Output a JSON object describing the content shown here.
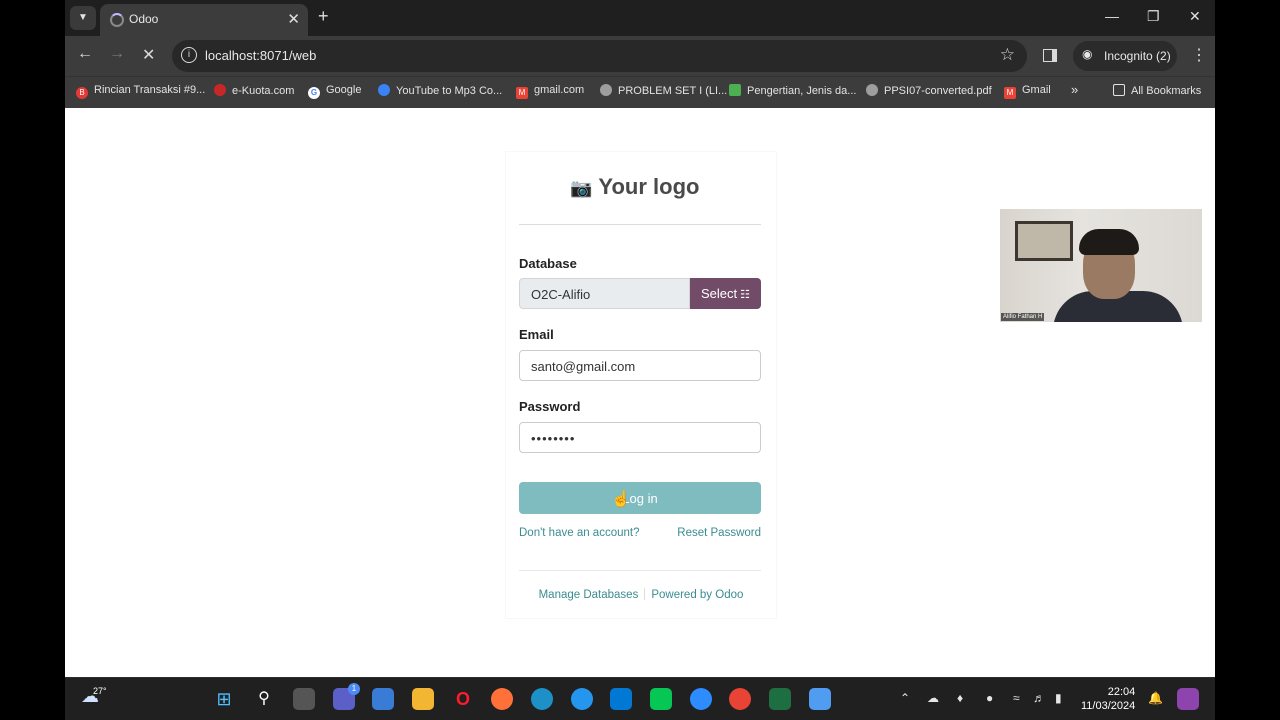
{
  "browser": {
    "tab_title": "Odoo",
    "url": "localhost:8071/web",
    "profile_label": "Incognito (2)",
    "bookmarks": [
      {
        "label": "Rincian Transaksi #9...",
        "icon": "red-circle",
        "color": "#e53935"
      },
      {
        "label": "e-Kuota.com",
        "icon": "red-pin",
        "color": "#c62828"
      },
      {
        "label": "Google",
        "icon": "google-g",
        "color": "#4285f4"
      },
      {
        "label": "YouTube to Mp3 Co...",
        "icon": "cloud-icon",
        "color": "#3b82f6"
      },
      {
        "label": "gmail.com",
        "icon": "gmail-icon",
        "color": "#ea4335"
      },
      {
        "label": "PROBLEM SET I (LI...",
        "icon": "globe-icon",
        "color": "#9e9e9e"
      },
      {
        "label": "Pengertian, Jenis da...",
        "icon": "site-icon",
        "color": "#4caf50"
      },
      {
        "label": "PPSI07-converted.pdf",
        "icon": "globe-icon",
        "color": "#9e9e9e"
      },
      {
        "label": "Gmail",
        "icon": "gmail-icon",
        "color": "#ea4335"
      }
    ],
    "all_bookmarks_label": "All Bookmarks"
  },
  "login": {
    "logo_text": "Your logo",
    "database_label": "Database",
    "database_value": "O2C-Alifio",
    "select_label": "Select",
    "email_label": "Email",
    "email_value": "santo@gmail.com",
    "password_label": "Password",
    "password_value": "••••••••",
    "login_label": "Log in",
    "signup_link": "Don't have an account?",
    "reset_link": "Reset Password",
    "manage_db_link": "Manage Databases",
    "powered_by_link": "Powered by Odoo",
    "accent_color": "#714b67",
    "button_color": "#7fbcc0",
    "link_color": "#3b8c91"
  },
  "webcam": {
    "name": "Alifio Fathan H"
  },
  "taskbar": {
    "temperature": "27°",
    "chat_badge": "1",
    "time": "22:04",
    "date": "11/03/2024"
  }
}
